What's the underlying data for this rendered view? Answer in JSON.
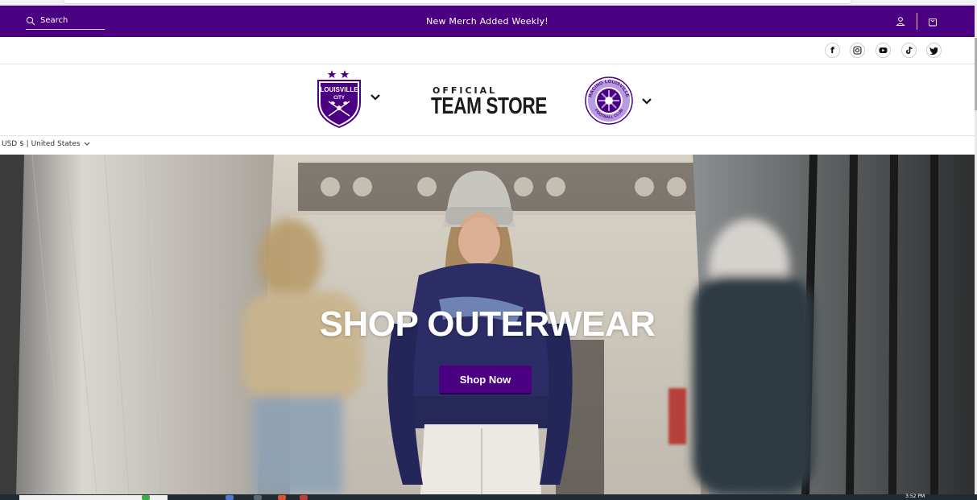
{
  "announcement": {
    "search_placeholder": "Search",
    "message": "New Merch Added Weekly!",
    "account_icon": "person-icon",
    "cart_icon": "shopping-bag-icon"
  },
  "social": [
    {
      "icon": "facebook-icon",
      "glyph": "f"
    },
    {
      "icon": "instagram-icon",
      "glyph": "◎"
    },
    {
      "icon": "youtube-icon",
      "glyph": "▶"
    },
    {
      "icon": "tiktok-icon",
      "glyph": "♪"
    },
    {
      "icon": "twitter-icon",
      "glyph": "🐦"
    }
  ],
  "header": {
    "store_small": "OFFICIAL",
    "store_title": "TEAM STORE",
    "lou_crest_text_1": "LOUISVILLE",
    "lou_crest_text_2": "CITY",
    "racing_crest_text_top": "RACING LOUISVILLE",
    "racing_crest_text_bottom": "FOOTBALL CLUB"
  },
  "currency": {
    "label": "USD $ | United States"
  },
  "hero": {
    "title": "SHOP OUTERWEAR",
    "button_label": "Shop Now"
  },
  "taskbar": {
    "clock": "3:52 PM"
  },
  "colors": {
    "brand_purple": "#4b0082",
    "white": "#ffffff"
  }
}
